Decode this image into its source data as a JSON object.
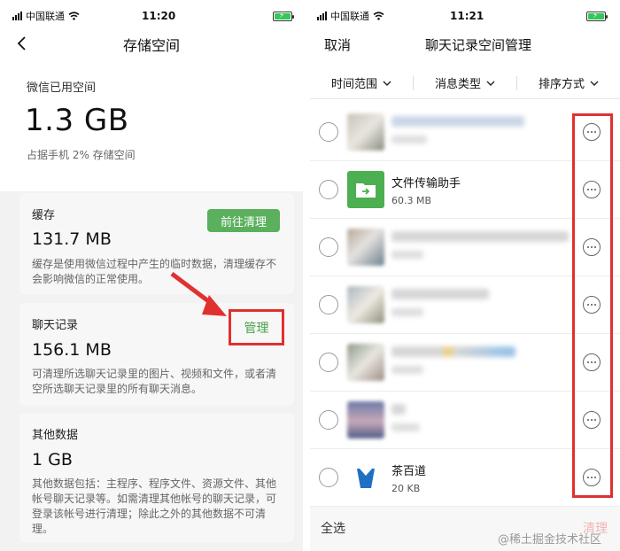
{
  "left": {
    "status": {
      "carrier": "中国联通",
      "time": "11:20"
    },
    "nav_title": "存储空间",
    "used_label": "微信已用空间",
    "used_value": "1.3 GB",
    "used_sub": "占据手机 2% 存储空间",
    "cache": {
      "label": "缓存",
      "size": "131.7 MB",
      "button": "前往清理",
      "desc": "缓存是使用微信过程中产生的临时数据，清理缓存不会影响微信的正常使用。"
    },
    "chat": {
      "label": "聊天记录",
      "size": "156.1 MB",
      "button": "管理",
      "desc": "可清理所选聊天记录里的图片、视频和文件，或者清空所选聊天记录里的所有聊天消息。"
    },
    "other": {
      "label": "其他数据",
      "size": "1 GB",
      "desc": "其他数据包括：主程序、程序文件、资源文件、其他帐号聊天记录等。如需清理其他帐号的聊天记录，可登录该帐号进行清理；除此之外的其他数据不可清理。"
    }
  },
  "right": {
    "status": {
      "carrier": "中国联通",
      "time": "11:21"
    },
    "cancel": "取消",
    "title": "聊天记录空间管理",
    "filters": [
      "时间范围",
      "消息类型",
      "排序方式"
    ],
    "rows": [
      {
        "name": "",
        "size": "",
        "blurred": true
      },
      {
        "name": "文件传输助手",
        "size": "60.3 MB",
        "blurred": false,
        "icon": "file-transfer-icon"
      },
      {
        "name": "",
        "size": "",
        "blurred": true
      },
      {
        "name": "",
        "size": "",
        "blurred": true
      },
      {
        "name": "",
        "size": "",
        "blurred": true
      },
      {
        "name": "",
        "size": "",
        "blurred": true
      },
      {
        "name": "茶百道",
        "size": "20 KB",
        "blurred": false,
        "icon": "cup-logo-icon"
      }
    ],
    "select_all": "全选",
    "clean": "清理"
  },
  "watermark": "@稀土掘金技术社区",
  "colors": {
    "accent_green": "#5ab05d",
    "highlight_red": "#e03030",
    "bg_gray": "#f2f2f2"
  }
}
